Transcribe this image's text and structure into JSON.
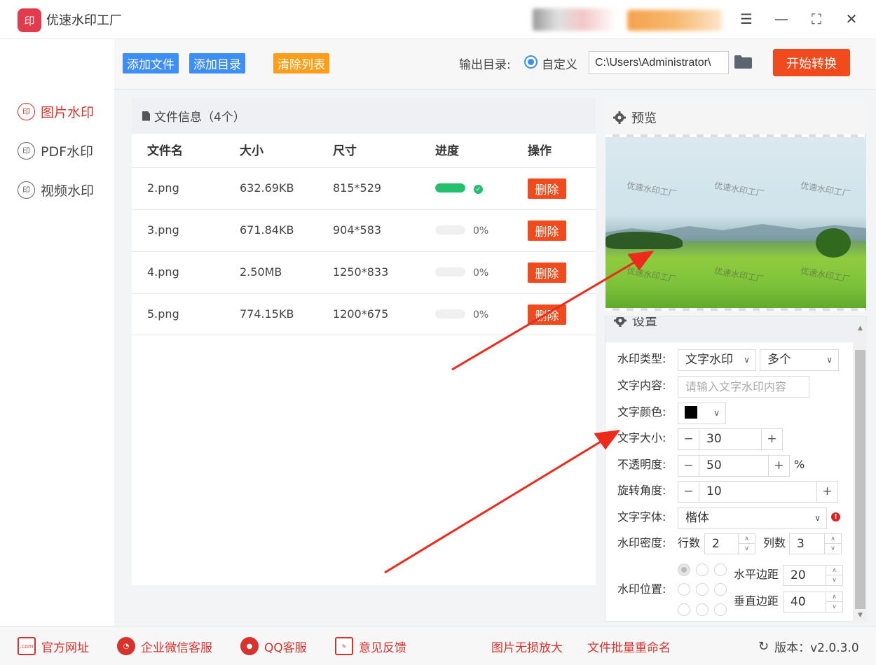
{
  "app": {
    "title": "优速水印工厂",
    "logo": "印"
  },
  "window_controls": [
    "☰",
    "—",
    "⛶",
    "✕"
  ],
  "sidebar": {
    "items": [
      {
        "label": "图片水印",
        "icon": "印",
        "active": true
      },
      {
        "label": "PDF水印",
        "icon": "印",
        "active": false
      },
      {
        "label": "视频水印",
        "icon": "印",
        "active": false
      }
    ]
  },
  "toolbar": {
    "add_file": "添加文件",
    "add_dir": "添加目录",
    "clear_list": "清除列表",
    "output_label": "输出目录:",
    "radio_label": "自定义",
    "output_path": "C:\\Users\\Administrator\\",
    "start": "开始转换"
  },
  "file_panel": {
    "title": "文件信息（4个）",
    "columns": [
      "文件名",
      "大小",
      "尺寸",
      "进度",
      "操作"
    ],
    "rows": [
      {
        "name": "2.png",
        "size": "632.69KB",
        "dims": "815*529",
        "progress": 100,
        "pct": "",
        "action": "删除"
      },
      {
        "name": "3.png",
        "size": "671.84KB",
        "dims": "904*583",
        "progress": 0,
        "pct": "0%",
        "action": "删除"
      },
      {
        "name": "4.png",
        "size": "2.50MB",
        "dims": "1250*833",
        "progress": 0,
        "pct": "0%",
        "action": "删除"
      },
      {
        "name": "5.png",
        "size": "774.15KB",
        "dims": "1200*675",
        "progress": 0,
        "pct": "0%",
        "action": "删除"
      }
    ]
  },
  "preview": {
    "title": "预览",
    "watermark_text": "优速水印工厂"
  },
  "settings": {
    "title": "设置",
    "type_label": "水印类型:",
    "type_value": "文字水印",
    "type_mode": "多个",
    "content_label": "文字内容:",
    "content_placeholder": "请输入文字水印内容",
    "color_label": "文字颜色:",
    "color_value": "#000000",
    "size_label": "文字大小:",
    "size_value": "30",
    "opacity_label": "不透明度:",
    "opacity_value": "50",
    "opacity_unit": "%",
    "rotate_label": "旋转角度:",
    "rotate_value": "10",
    "font_label": "文字字体:",
    "font_value": "楷体",
    "density_label": "水印密度:",
    "rows_label": "行数",
    "rows_value": "2",
    "cols_label": "列数",
    "cols_value": "3",
    "position_label": "水印位置:",
    "h_margin_label": "水平边距",
    "h_margin_value": "20",
    "v_margin_label": "垂直边距",
    "v_margin_value": "40"
  },
  "footer": {
    "site": "官方网址",
    "wechat": "企业微信客服",
    "qq": "QQ客服",
    "feedback": "意见反馈",
    "upscale": "图片无损放大",
    "rename": "文件批量重命名",
    "version": "版本：v2.0.3.0"
  },
  "colors": {
    "accent_red": "#f04a1d",
    "blue": "#3e8ef7",
    "orange": "#fb9e1a",
    "green": "#24c06e"
  }
}
